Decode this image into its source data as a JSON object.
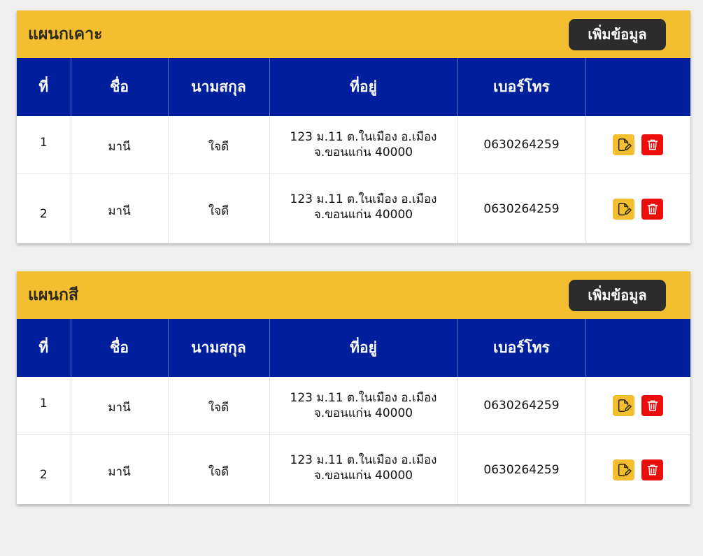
{
  "add_label": "เพิ่มข้อมูล",
  "columns": [
    "ที่",
    "ชื่อ",
    "นามสกุล",
    "ที่อยู่",
    "เบอร์โทร",
    ""
  ],
  "sections": [
    {
      "title": "แผนกเคาะ",
      "rows": [
        {
          "no": "1",
          "first_name": "มานี",
          "last_name": "ใจดี",
          "address_line1": "123 ม.11 ต.ในเมือง อ.เมือง",
          "address_line2": "จ.ขอนแก่น 40000",
          "phone": "0630264259"
        },
        {
          "no": "2",
          "first_name": "มานี",
          "last_name": "ใจดี",
          "address_line1": "123 ม.11 ต.ในเมือง อ.เมือง",
          "address_line2": "จ.ขอนแก่น 40000",
          "phone": "0630264259"
        }
      ]
    },
    {
      "title": "แผนกสี",
      "rows": [
        {
          "no": "1",
          "first_name": "มานี",
          "last_name": "ใจดี",
          "address_line1": "123 ม.11 ต.ในเมือง อ.เมือง",
          "address_line2": "จ.ขอนแก่น 40000",
          "phone": "0630264259"
        },
        {
          "no": "2",
          "first_name": "มานี",
          "last_name": "ใจดี",
          "address_line1": "123 ม.11 ต.ในเมือง อ.เมือง",
          "address_line2": "จ.ขอนแก่น 40000",
          "phone": "0630264259"
        }
      ]
    }
  ],
  "icons": {
    "edit": "edit-note-icon",
    "delete": "trash-icon"
  },
  "colors": {
    "header_bar": "#f3be2f",
    "table_header": "#001f9d",
    "add_button": "#2c2c2c",
    "edit_button": "#f3be2f",
    "delete_button": "#ee0d0d"
  }
}
